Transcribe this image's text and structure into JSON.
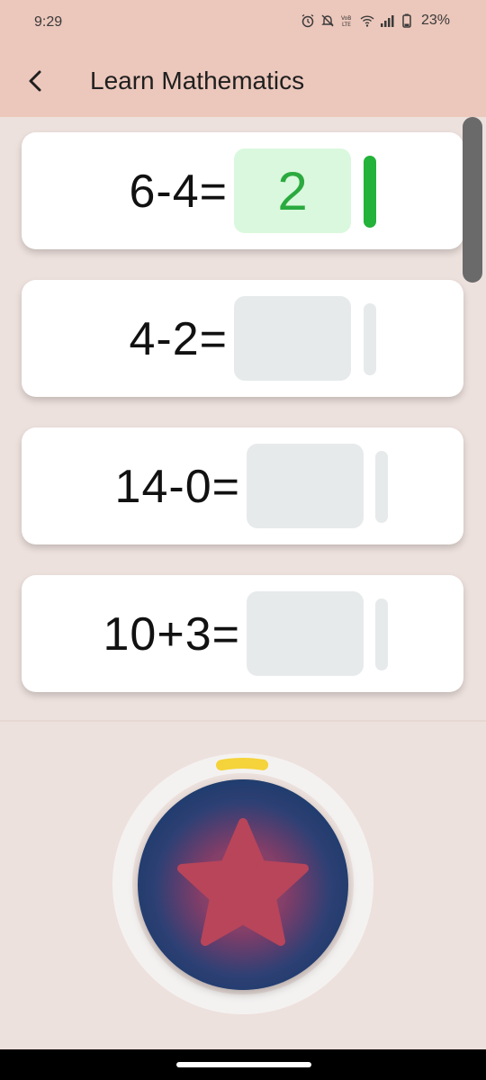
{
  "status_bar": {
    "time": "9:29",
    "battery": "23%",
    "icons": [
      "alarm-icon",
      "mute-icon",
      "volte-icon",
      "wifi-icon",
      "signal-icon",
      "battery-icon"
    ]
  },
  "app_bar": {
    "title": "Learn Mathematics",
    "back_icon": "back-arrow-icon"
  },
  "questions": [
    {
      "equation": "6-4=",
      "answer": "2",
      "state": "correct"
    },
    {
      "equation": "4-2=",
      "answer": "",
      "state": "empty"
    },
    {
      "equation": "14-0=",
      "answer": "",
      "state": "empty"
    },
    {
      "equation": "10+3=",
      "answer": "",
      "state": "empty"
    }
  ],
  "progress": {
    "fraction": 0.1,
    "color": "#F5D33A"
  },
  "colors": {
    "app_bar": "#ECC7BB",
    "background": "#EDE1DD",
    "correct_green": "#23B23A",
    "correct_bg": "#DAF8DD",
    "empty_box": "#E7EAEB",
    "star": "#B8455A",
    "orb_dark": "#1F3E6E"
  },
  "star_button": {
    "icon": "star-icon"
  }
}
